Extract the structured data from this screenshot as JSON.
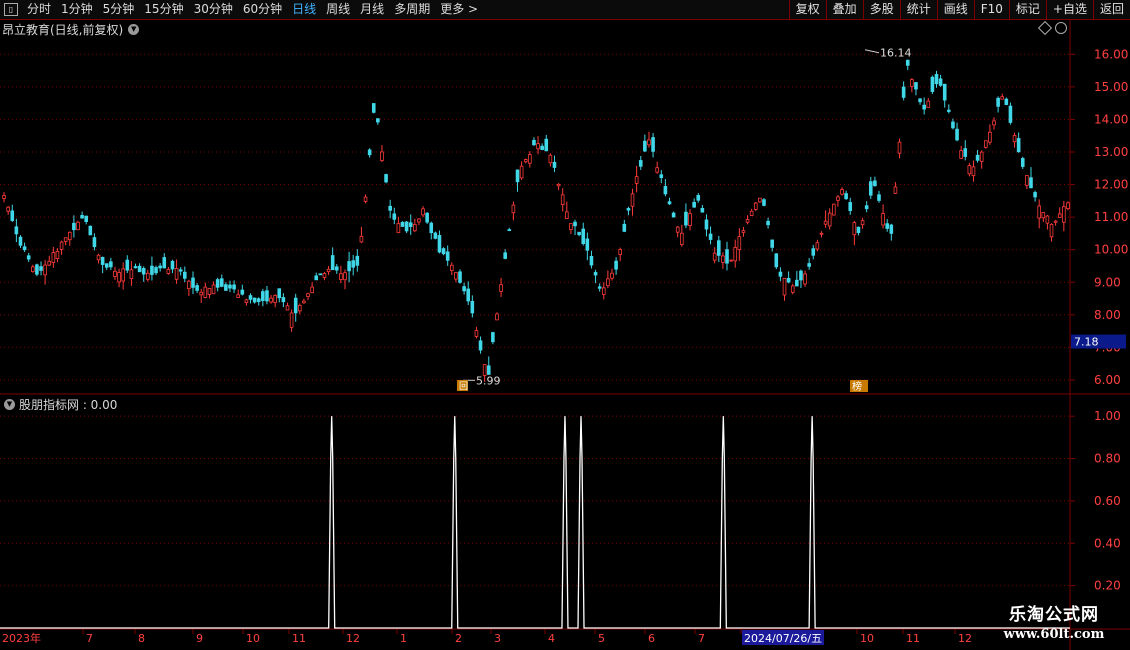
{
  "toolbar": {
    "periods": [
      "分时",
      "1分钟",
      "5分钟",
      "15分钟",
      "30分钟",
      "60分钟",
      "日线",
      "周线",
      "月线",
      "多周期",
      "更多 >"
    ],
    "active_index": 6,
    "right_buttons": [
      "复权",
      "叠加",
      "多股",
      "统计",
      "画线",
      "F10",
      "标记",
      "+自选",
      "返回"
    ]
  },
  "stock_title": "昂立教育(日线,前复权)",
  "indicator_title": "股朋指标网 : 0.00",
  "price_axis": [
    "16.00",
    "15.00",
    "14.00",
    "13.00",
    "12.00",
    "11.00",
    "10.00",
    "9.00",
    "8.00",
    "7.00",
    "6.00"
  ],
  "current_price": "7.18",
  "high_label": "16.14",
  "low_label": "5.99",
  "markers": {
    "low_marker": "回",
    "event_marker": "榜"
  },
  "indicator_axis": [
    "1.00",
    "0.80",
    "0.60",
    "0.40",
    "0.20"
  ],
  "date_axis": [
    "2023年",
    "7",
    "8",
    "9",
    "10",
    "11",
    "12",
    "1",
    "2",
    "3",
    "4",
    "5",
    "6",
    "7",
    "2024/07/26/五",
    "10",
    "11",
    "12"
  ],
  "watermark": {
    "line1": "乐淘公式网",
    "line2": "www.60lt.com"
  },
  "colors": {
    "up": "#ff3b3b",
    "down": "#40d8e8",
    "grid": "#7a0000",
    "active": "#3fb4ff"
  },
  "chart_data": [
    {
      "type": "candlestick",
      "title": "昂立教育(日线,前复权)",
      "ylim": [
        5.6,
        16.5
      ],
      "yticks": [
        6,
        7,
        8,
        9,
        10,
        11,
        12,
        13,
        14,
        15,
        16
      ],
      "annotated_high": 16.14,
      "annotated_low": 5.99,
      "last_price": 7.18,
      "x_labels": [
        "2023年",
        "7",
        "8",
        "9",
        "10",
        "11",
        "12",
        "1",
        "2",
        "3",
        "4",
        "5",
        "6",
        "7",
        "2024/07/26/五",
        "10",
        "11",
        "12"
      ],
      "close_trend": [
        11.7,
        10.2,
        9.2,
        9.8,
        10.5,
        11.0,
        9.6,
        9.3,
        9.4,
        9.2,
        9.5,
        9.3,
        8.7,
        8.9,
        8.8,
        8.5,
        8.4,
        8.6,
        8.0,
        8.8,
        9.4,
        9.3,
        9.5,
        14.6,
        11.0,
        10.5,
        11.2,
        10.0,
        9.3,
        8.2,
        6.0,
        9.5,
        12.5,
        13.3,
        12.8,
        11.0,
        10.2,
        8.7,
        9.5,
        11.8,
        13.4,
        11.8,
        10.4,
        11.6,
        10.0,
        9.6,
        10.8,
        11.7,
        9.3,
        8.8,
        9.5,
        11.0,
        11.9,
        10.5,
        12.0,
        10.3,
        15.8,
        14.2,
        15.3,
        13.5,
        12.4,
        13.4,
        14.8,
        12.9,
        11.5,
        10.8,
        11.4
      ]
    },
    {
      "type": "line",
      "title": "股朋指标网",
      "value_label": "0.00",
      "ylim": [
        0,
        1.1
      ],
      "yticks": [
        0.2,
        0.4,
        0.6,
        0.8,
        1.0
      ],
      "spike_positions": [
        0.31,
        0.425,
        0.528,
        0.543,
        0.676,
        0.759
      ],
      "spike_value": 1.0,
      "baseline": 0.0
    }
  ]
}
